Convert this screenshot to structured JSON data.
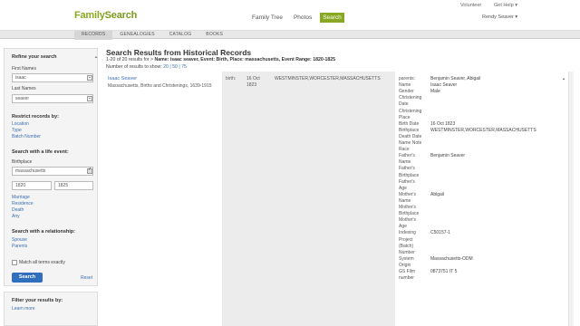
{
  "header": {
    "logo_family": "Family",
    "logo_search": "Search",
    "nav": [
      "Family Tree",
      "Photos",
      "Search"
    ],
    "utility": {
      "volunteer": "Volunteer",
      "help": "Get Help ▾"
    },
    "user": "Rendy Seaver ▾",
    "accent_color": "#88a822"
  },
  "tabs": [
    "RECORDS",
    "GENEALOGIES",
    "CATALOG",
    "BOOKS"
  ],
  "sidebar": {
    "refine_heading": "Refine your search",
    "first_names_label": "First Names",
    "first_names_value": "isaac",
    "last_names_label": "Last Names",
    "last_names_value": "seaver",
    "restrict_heading": "Restrict records by:",
    "restrict_links": [
      "Location",
      "Type",
      "Batch Number"
    ],
    "life_event_heading": "Search with a life event:",
    "birthplace_label": "Birthplace",
    "birthplace_value": "massachusetts",
    "year_from": "1820",
    "year_to": "1825",
    "event_links": [
      "Marriage",
      "Residence",
      "Death",
      "Any"
    ],
    "relationship_heading": "Search with a relationship:",
    "relationship_links": [
      "Spouse",
      "Parents"
    ],
    "match_exact_label": "Match all terms exactly",
    "search_button": "Search",
    "reset_link": "Reset",
    "filter_heading": "Filter your results by:",
    "learn_more": "Learn more"
  },
  "results": {
    "title": "Search Results from Historical Records",
    "summary_prefix": "1-20 of 20 results for",
    "summary_criteria": "Name: isaac seaver, Event: Birth, Place: massachusetts, Event Range: 1820-1825",
    "show_label": "Number of results to show:",
    "show_options": "20 | 50 | 75",
    "first_result": {
      "name": "Isaac Seaver",
      "collection": "Massachusetts, Births and Christenings, 1639-1915",
      "event_type": "birth:",
      "event_date": "16 Oct 1823",
      "event_place": "WESTMINSTER,WORCESTER,MASSACHUSETTS"
    }
  },
  "detail": [
    {
      "label": "parents:",
      "value": "Benjamin Seaver, Abigail"
    },
    {
      "label": "Name",
      "value": "Isaac Seaver"
    },
    {
      "label": "Gender",
      "value": "Male"
    },
    {
      "label": "Christening",
      "value": ""
    },
    {
      "label": "Date",
      "value": ""
    },
    {
      "label": "Christening",
      "value": ""
    },
    {
      "label": "Place",
      "value": ""
    },
    {
      "label": "Birth Date",
      "value": "16 Oct 1823"
    },
    {
      "label": "Birthplace",
      "value": "WESTMINSTER,WORCESTER,MASSACHUSETTS"
    },
    {
      "label": "Death Date",
      "value": ""
    },
    {
      "label": "Name Note",
      "value": ""
    },
    {
      "label": "Race",
      "value": ""
    },
    {
      "label": "Father's",
      "value": "Benjamin Seaver"
    },
    {
      "label": "Name",
      "value": ""
    },
    {
      "label": "Father's",
      "value": ""
    },
    {
      "label": "Birthplace",
      "value": ""
    },
    {
      "label": "Father's",
      "value": ""
    },
    {
      "label": "Age",
      "value": ""
    },
    {
      "label": "Mother's",
      "value": "Abigail"
    },
    {
      "label": "Name",
      "value": ""
    },
    {
      "label": "Mother's",
      "value": ""
    },
    {
      "label": "Birthplace",
      "value": ""
    },
    {
      "label": "Mother's",
      "value": ""
    },
    {
      "label": "Age",
      "value": ""
    },
    {
      "label": "Indexing",
      "value": "C50157-1"
    },
    {
      "label": "Project",
      "value": ""
    },
    {
      "label": "(Batch)",
      "value": ""
    },
    {
      "label": "Number",
      "value": ""
    },
    {
      "label": "System",
      "value": "Massachusetts-ODM"
    },
    {
      "label": "Origin",
      "value": ""
    },
    {
      "label": "GS Film",
      "value": "0873751 IT 5"
    },
    {
      "label": "number",
      "value": ""
    }
  ]
}
